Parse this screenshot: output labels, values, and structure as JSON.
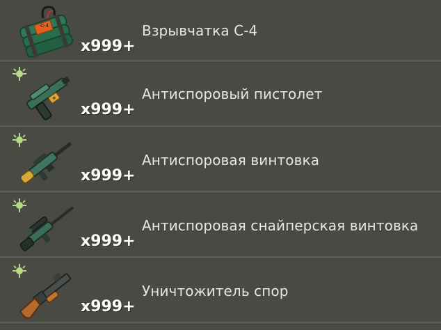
{
  "inventory": {
    "items": [
      {
        "name": "Взрывчатка С-4",
        "count": "x999+",
        "icon": "c4-explosive-icon",
        "spore_badge": false,
        "explosive_label": "C-4"
      },
      {
        "name": "Антиспоровый пистолет",
        "count": "x999+",
        "icon": "anti-spore-pistol-icon",
        "spore_badge": true
      },
      {
        "name": "Антиспоровая винтовка",
        "count": "x999+",
        "icon": "anti-spore-rifle-icon",
        "spore_badge": true
      },
      {
        "name": "Антиспоровая снайперская винтовка",
        "count": "x999+",
        "icon": "anti-spore-sniper-rifle-icon",
        "spore_badge": true
      },
      {
        "name": "Уничтожитель спор",
        "count": "x999+",
        "icon": "spore-destroyer-icon",
        "spore_badge": true
      }
    ]
  },
  "colors": {
    "background": "#4a4a44",
    "divider": "#5b5b55",
    "text": "#e7e7e2",
    "count_text": "#ffffff",
    "spore_badge": "#b8d98a"
  }
}
